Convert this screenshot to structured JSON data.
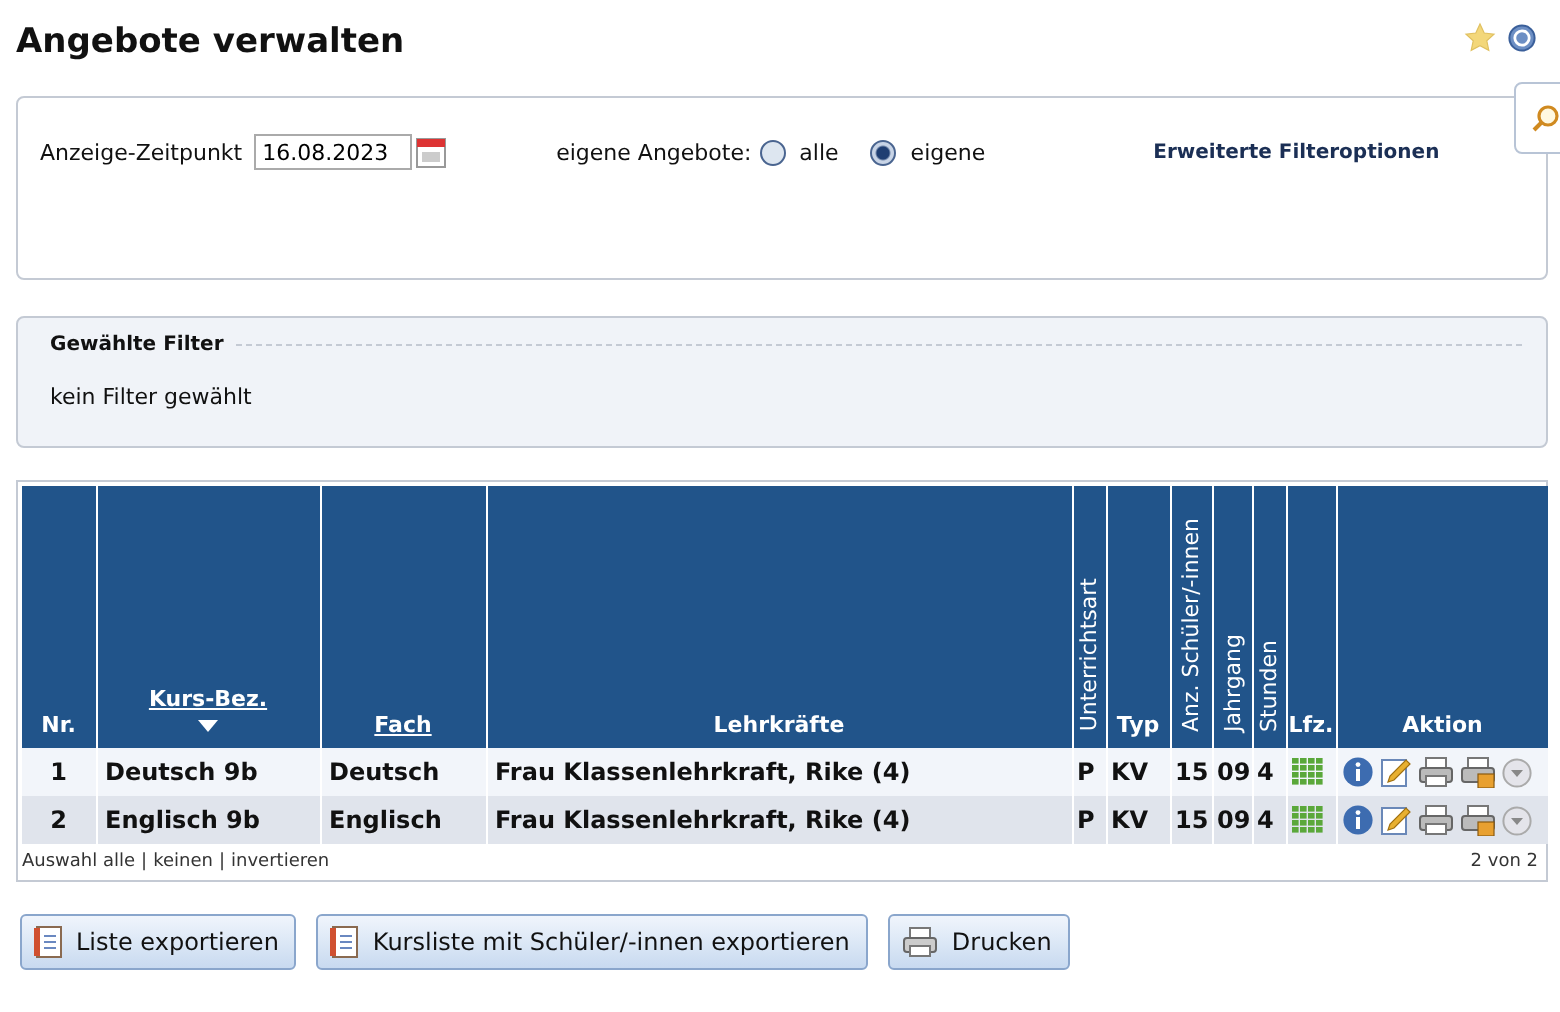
{
  "page": {
    "title": "Angebote verwalten"
  },
  "filter": {
    "date_label": "Anzeige-Zeitpunkt",
    "date_value": "16.08.2023",
    "own_label": "eigene Angebote:",
    "options": [
      {
        "label": "alle",
        "selected": false
      },
      {
        "label": "eigene",
        "selected": true
      }
    ],
    "advanced_link": "Erweiterte Filteroptionen"
  },
  "chosen_filter": {
    "title": "Gewählte Filter",
    "text": "kein Filter gewählt"
  },
  "table": {
    "columns": [
      {
        "label": "Nr.",
        "vertical": false,
        "sortable": false,
        "sorted": false
      },
      {
        "label": "Kurs-Bez.",
        "vertical": false,
        "sortable": true,
        "sorted": true
      },
      {
        "label": "Fach",
        "vertical": false,
        "sortable": true,
        "sorted": false
      },
      {
        "label": "Lehrkräfte",
        "vertical": false,
        "sortable": false,
        "sorted": false
      },
      {
        "label": "Unterrichtsart",
        "vertical": true,
        "sortable": false,
        "sorted": false
      },
      {
        "label": "Typ",
        "vertical": false,
        "sortable": false,
        "sorted": false
      },
      {
        "label": "Anz. Schüler/-innen",
        "vertical": true,
        "sortable": false,
        "sorted": false
      },
      {
        "label": "Jahrgang",
        "vertical": true,
        "sortable": false,
        "sorted": false
      },
      {
        "label": "Stunden",
        "vertical": true,
        "sortable": false,
        "sorted": false
      },
      {
        "label": "Lfz.",
        "vertical": false,
        "sortable": false,
        "sorted": false
      },
      {
        "label": "Aktion",
        "vertical": false,
        "sortable": false,
        "sorted": false
      }
    ],
    "rows": [
      {
        "cells": [
          "1",
          "Deutsch 9b",
          "Deutsch",
          "Frau Klassenlehrkraft, Rike (4)",
          "P",
          "KV",
          "15",
          "09",
          "4"
        ]
      },
      {
        "cells": [
          "2",
          "Englisch 9b",
          "Englisch",
          "Frau Klassenlehrkraft, Rike (4)",
          "P",
          "KV",
          "15",
          "09",
          "4"
        ]
      }
    ],
    "selection_links": [
      "Auswahl alle",
      "keinen",
      "invertieren"
    ],
    "selection_separator": "|",
    "count": "2 von 2"
  },
  "buttons": [
    {
      "label": "Liste exportieren",
      "kind": "export"
    },
    {
      "label": "Kursliste mit Schüler/-innen exportieren",
      "kind": "export"
    },
    {
      "label": "Drucken",
      "kind": "print"
    }
  ]
}
